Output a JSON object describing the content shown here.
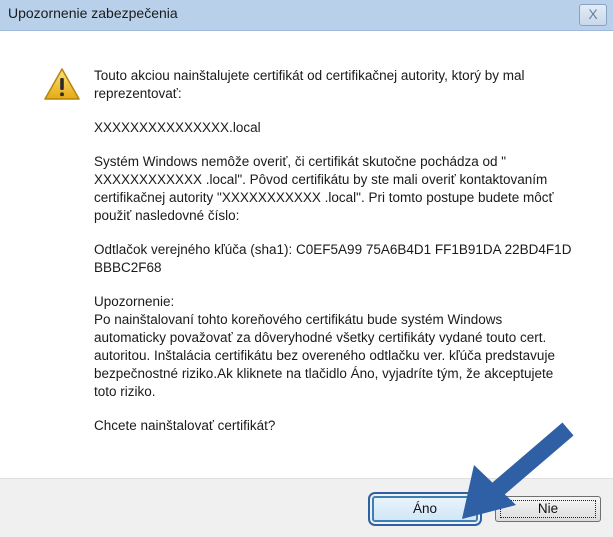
{
  "window": {
    "title": "Upozornenie zabezpečenia",
    "close_glyph": "X"
  },
  "message": {
    "intro": "Touto akciou nainštalujete certifikát od certifikačnej autority, ktorý by mal reprezentovať:",
    "host": "XXXXXXXXXXXXXXX.local",
    "verify": "Systém Windows nemôže overiť, či certifikát skutočne pochádza od \" XXXXXXXXXXXX .local\". Pôvod certifikátu by ste mali overiť kontaktovaním certifikačnej autority \"XXXXXXXXXXX .local\". Pri tomto postupe budete môcť použiť nasledovné číslo:",
    "thumbprint": "Odtlačok verejného kľúča (sha1): C0EF5A99 75A6B4D1 FF1B91DA 22BD4F1D BBBC2F68",
    "warning_heading": "Upozornenie:",
    "warning_text": "Po nainštalovaní tohto koreňového certifikátu bude systém Windows automaticky považovať za dôveryhodné všetky certifikáty vydané touto cert. autoritou. Inštalácia certifikátu bez overeného odtlačku ver. kľúča predstavuje bezpečnostné riziko.Ak kliknete na tlačidlo Áno, vyjadríte tým, že akceptujete toto riziko.",
    "question": "Chcete nainštalovať certifikát?"
  },
  "buttons": {
    "yes_label": "Áno",
    "no_label": "Nie"
  },
  "icons": {
    "warning": "warning-triangle-icon",
    "arrow": "pointer-arrow-icon",
    "close": "close-icon"
  },
  "colors": {
    "titlebar": "#b8d0ea",
    "arrow": "#2f5fa5",
    "warning_fill": "#f3c431"
  }
}
